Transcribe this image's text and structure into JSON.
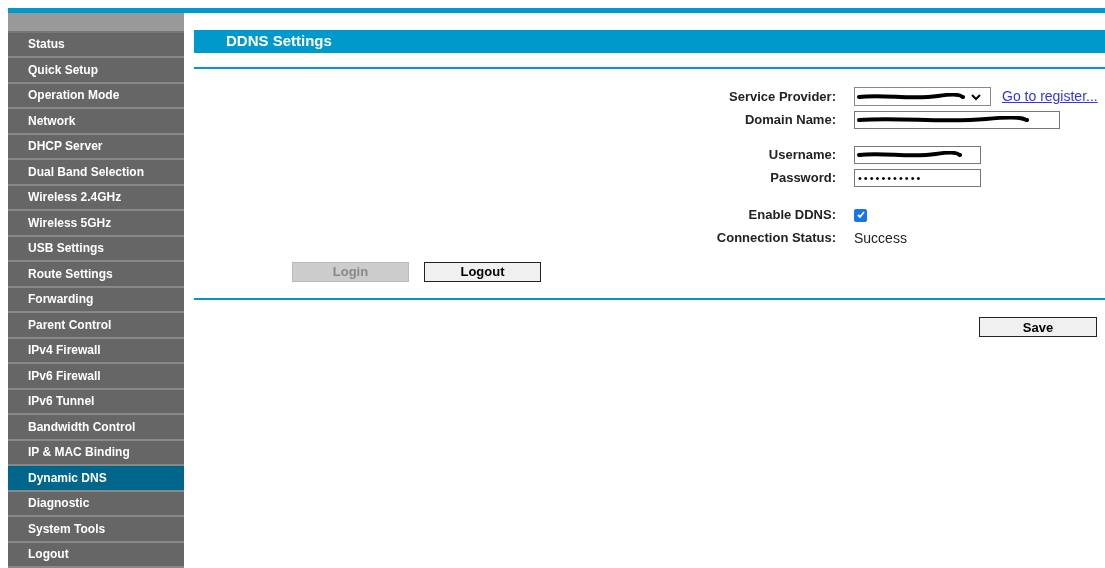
{
  "sidebar": {
    "items": [
      {
        "label": "Status",
        "selected": false
      },
      {
        "label": "Quick Setup",
        "selected": false
      },
      {
        "label": "Operation Mode",
        "selected": false
      },
      {
        "label": "Network",
        "selected": false
      },
      {
        "label": "DHCP Server",
        "selected": false
      },
      {
        "label": "Dual Band Selection",
        "selected": false
      },
      {
        "label": "Wireless 2.4GHz",
        "selected": false
      },
      {
        "label": "Wireless 5GHz",
        "selected": false
      },
      {
        "label": "USB Settings",
        "selected": false
      },
      {
        "label": "Route Settings",
        "selected": false
      },
      {
        "label": "Forwarding",
        "selected": false
      },
      {
        "label": "Parent Control",
        "selected": false
      },
      {
        "label": "IPv4 Firewall",
        "selected": false
      },
      {
        "label": "IPv6 Firewall",
        "selected": false
      },
      {
        "label": "IPv6 Tunnel",
        "selected": false
      },
      {
        "label": "Bandwidth Control",
        "selected": false
      },
      {
        "label": "IP & MAC Binding",
        "selected": false
      },
      {
        "label": "Dynamic DNS",
        "selected": true
      },
      {
        "label": "Diagnostic",
        "selected": false
      },
      {
        "label": "System Tools",
        "selected": false
      },
      {
        "label": "Logout",
        "selected": false
      }
    ]
  },
  "title": "DDNS Settings",
  "form": {
    "service_provider": {
      "label": "Service Provider:",
      "link": "Go to register..."
    },
    "domain_name": {
      "label": "Domain Name:"
    },
    "username": {
      "label": "Username:"
    },
    "password": {
      "label": "Password:",
      "value": "•••••••••••"
    },
    "enable_ddns": {
      "label": "Enable DDNS:",
      "checked": true
    },
    "connection_status": {
      "label": "Connection Status:",
      "value": "Success"
    }
  },
  "buttons": [
    {
      "label": "Login",
      "disabled": true
    },
    {
      "label": "Logout",
      "disabled": false
    }
  ],
  "save": {
    "label": "Save"
  }
}
